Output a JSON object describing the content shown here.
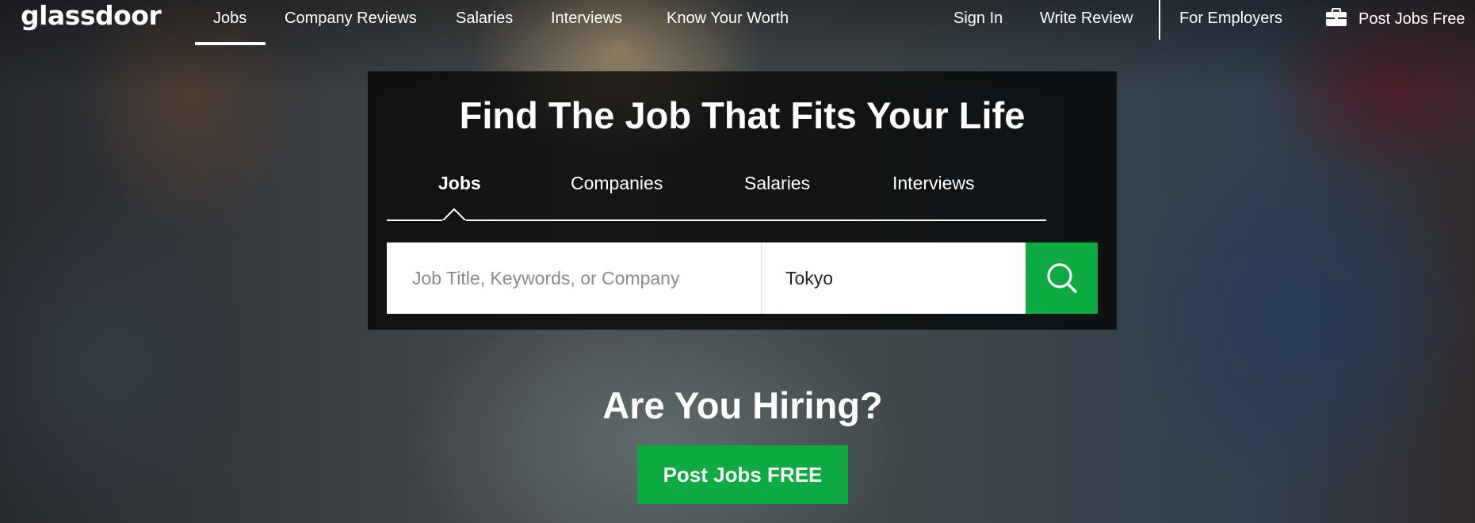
{
  "brand": {
    "logo": "glassdoor",
    "accent": "#0caa41"
  },
  "topnav": {
    "left_links": [
      "Jobs",
      "Company Reviews",
      "Salaries",
      "Interviews",
      "Know Your Worth"
    ],
    "active": "Jobs",
    "right_links": [
      "Sign In",
      "Write Review",
      "For Employers"
    ],
    "post_jobs": "Post Jobs Free"
  },
  "search_panel": {
    "headline": "Find The Job That Fits Your Life",
    "tabs": [
      "Jobs",
      "Companies",
      "Salaries",
      "Interviews"
    ],
    "active_tab": "Jobs",
    "keyword_placeholder": "Job Title, Keywords, or Company",
    "keyword_value": "",
    "location_value": "Tokyo"
  },
  "hiring": {
    "title": "Are You Hiring?",
    "button": "Post Jobs FREE"
  }
}
